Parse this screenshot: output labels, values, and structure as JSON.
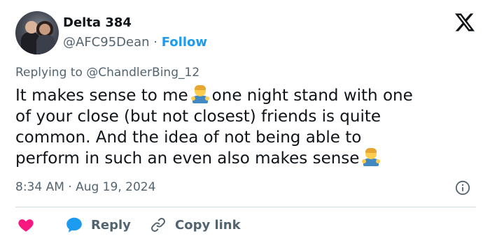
{
  "author": {
    "name": "Delta 384",
    "handle": "@AFC95Dean",
    "separator": "·",
    "follow_label": "Follow"
  },
  "reply_context": {
    "prefix": "Replying to",
    "mention": "@ChandlerBing_12"
  },
  "tweet": {
    "line1a": "It makes sense to me",
    "line1b": "one night stand with one",
    "line2": "of your close (but not closest) friends is quite",
    "line3": "common. And the idea of not being able to",
    "line4": "perform in such an even also makes sense",
    "emoji": "person-shrugging"
  },
  "meta": {
    "timestamp": "8:34 AM · Aug 19, 2024"
  },
  "actions": {
    "reply_label": "Reply",
    "copy_link_label": "Copy link"
  },
  "colors": {
    "accent": "#1d9bf0",
    "like": "#f91880",
    "muted": "#536471",
    "text": "#0f1419"
  },
  "icons": [
    "x-logo-icon",
    "info-icon",
    "heart-icon",
    "reply-bubble-icon",
    "link-icon"
  ]
}
